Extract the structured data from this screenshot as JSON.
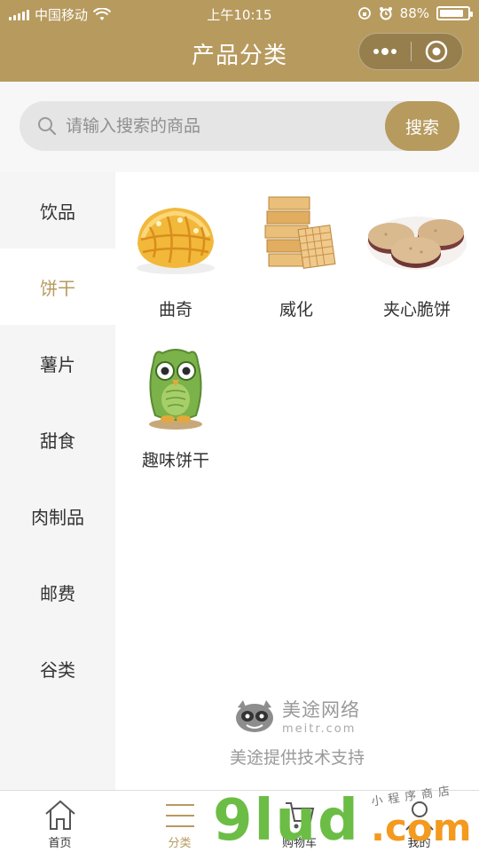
{
  "status_bar": {
    "carrier": "中国移动",
    "time": "上午10:15",
    "battery": "88%",
    "battery_level": 0.88
  },
  "nav": {
    "title": "产品分类"
  },
  "search": {
    "placeholder": "请输入搜索的商品",
    "button": "搜索"
  },
  "sidebar": {
    "items": [
      {
        "label": "饮品"
      },
      {
        "label": "饼干"
      },
      {
        "label": "薯片"
      },
      {
        "label": "甜食"
      },
      {
        "label": "肉制品"
      },
      {
        "label": "邮费"
      },
      {
        "label": "谷类"
      }
    ],
    "active_index": 1
  },
  "products": [
    {
      "name": "曲奇",
      "icon": "cookie-image"
    },
    {
      "name": "威化",
      "icon": "wafer-image"
    },
    {
      "name": "夹心脆饼",
      "icon": "sandwich-biscuit-image"
    },
    {
      "name": "趣味饼干",
      "icon": "owl-biscuit-image"
    }
  ],
  "brand": {
    "name": "美途网络",
    "domain": "meitr.com",
    "support": "美途提供技术支持"
  },
  "tabbar": {
    "items": [
      {
        "label": "首页",
        "icon": "home-icon"
      },
      {
        "label": "分类",
        "icon": "category-icon"
      },
      {
        "label": "购物车",
        "icon": "cart-icon"
      },
      {
        "label": "我的",
        "icon": "user-icon"
      }
    ],
    "active_index": 1
  },
  "watermark": {
    "main": "9lud",
    "suffix": ".com",
    "handwriting": "小程序商店"
  },
  "colors": {
    "accent": "#b79a5e",
    "sidebar_bg": "#f5f5f5",
    "search_bg": "#e5e5e5"
  }
}
